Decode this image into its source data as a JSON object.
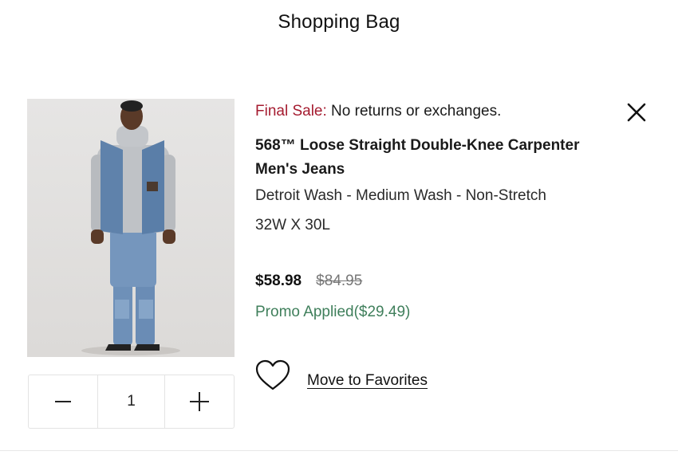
{
  "header": {
    "title": "Shopping Bag"
  },
  "item": {
    "image_alt": "Model wearing 568 Loose Straight Double-Knee Carpenter Men's Jeans",
    "final_sale_label": "Final Sale:",
    "final_sale_text": " No returns or exchanges.",
    "name": "568™ Loose Straight Double-Knee Carpenter Men's Jeans",
    "variant": "Detroit Wash - Medium Wash - Non-Stretch",
    "size": "32W X 30L",
    "price_current": "$58.98",
    "price_original": "$84.95",
    "promo": "Promo Applied($29.49)",
    "favorites_label": "Move to Favorites"
  },
  "quantity": {
    "value": "1"
  },
  "icons": {
    "close": "close-icon",
    "heart": "heart-icon",
    "minus": "minus-icon",
    "plus": "plus-icon"
  },
  "colors": {
    "final_sale": "#a51c30",
    "promo": "#3f7f5b",
    "strikethrough": "#777777"
  }
}
